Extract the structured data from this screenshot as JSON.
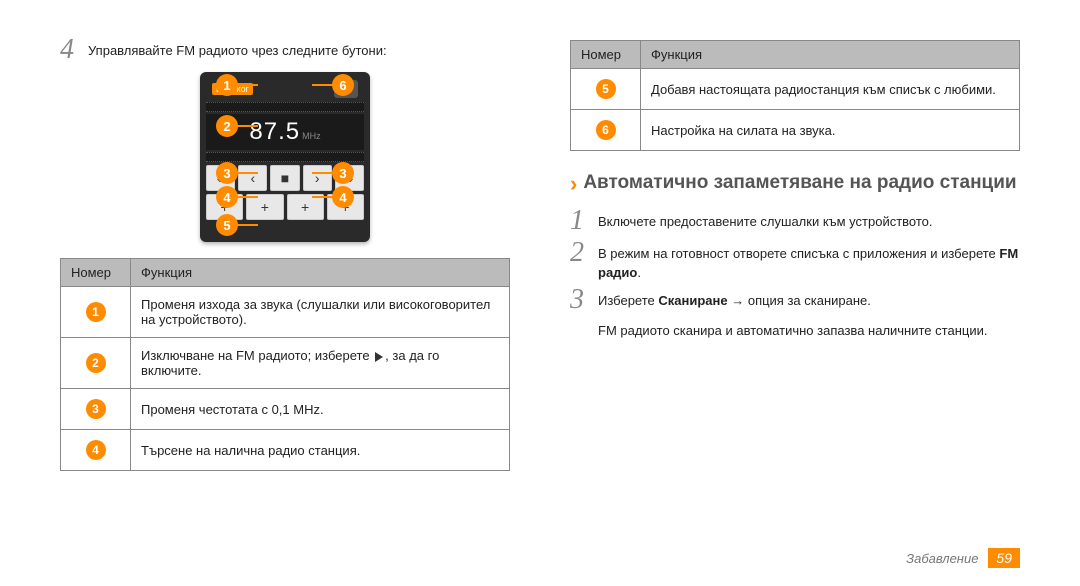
{
  "left": {
    "step4": {
      "num": "4",
      "text": "Управлявайте FM радиото чрез следните бутони:"
    },
    "radio": {
      "badge": "Високог",
      "freq": "87.5",
      "unit": "MHz",
      "row2": [
        "«",
        "‹",
        "■",
        "›",
        "»"
      ],
      "row3": [
        "+",
        "+",
        "+",
        "+"
      ]
    },
    "callouts": {
      "c1": "1",
      "c2": "2",
      "c3l": "3",
      "c3r": "3",
      "c4l": "4",
      "c4r": "4",
      "c5": "5",
      "c6": "6"
    },
    "table": {
      "hNum": "Номер",
      "hFunc": "Функция",
      "r1": "Променя изхода за звука (слушалки или високоговорител на устройството).",
      "r2a": "Изключване на FM радиото; изберете ",
      "r2b": ", за да го включите.",
      "r3": "Променя честотата с 0,1 MHz.",
      "r4": "Търсене на налична радио станция."
    }
  },
  "right": {
    "table": {
      "hNum": "Номер",
      "hFunc": "Функция",
      "r5": "Добавя настоящата радиостанция към списък с любими.",
      "r6": "Настройка на силата на звука."
    },
    "section": "Автоматично запаметяване на радио станции",
    "step1": {
      "num": "1",
      "text": "Включете предоставените слушалки към устройството."
    },
    "step2": {
      "num": "2",
      "a": "В режим на готовност отворете списъка с приложения и изберете ",
      "b": "FM радио",
      "c": "."
    },
    "step3": {
      "num": "3",
      "a": "Изберете ",
      "b": "Сканиране",
      "c": " → опция за сканиране."
    },
    "note": "FM радиото сканира и автоматично запазва наличните станции."
  },
  "footer": {
    "section": "Забавление",
    "page": "59"
  }
}
